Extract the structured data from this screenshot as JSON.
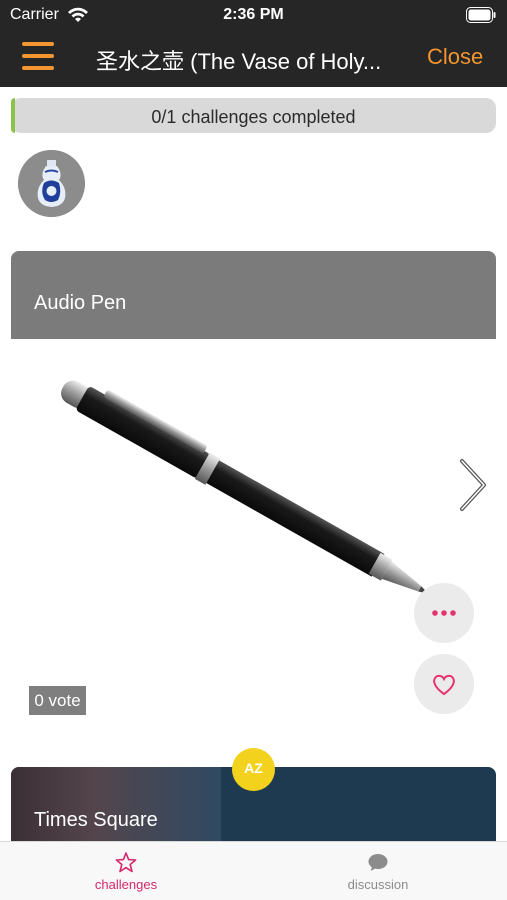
{
  "status_bar": {
    "carrier": "Carrier",
    "time": "2:36 PM"
  },
  "nav": {
    "title": "圣水之壶 (The Vase of Holy...",
    "close_label": "Close",
    "accent_color": "#f39530"
  },
  "progress": {
    "label": "0/1 challenges completed",
    "completed": 0,
    "total": 1,
    "fraction": 0.0
  },
  "cards": [
    {
      "title": "Audio Pen",
      "votes_label": "0 vote"
    },
    {
      "title": "Times Square",
      "badge": "AZ"
    }
  ],
  "tabs": [
    {
      "label": "challenges",
      "icon": "star-icon",
      "active": true
    },
    {
      "label": "discussion",
      "icon": "chat-bubble-icon",
      "active": false
    }
  ],
  "colors": {
    "active_tab": "#d4286b",
    "inactive_tab": "#8c8c8c",
    "nav_bg": "#262626"
  }
}
